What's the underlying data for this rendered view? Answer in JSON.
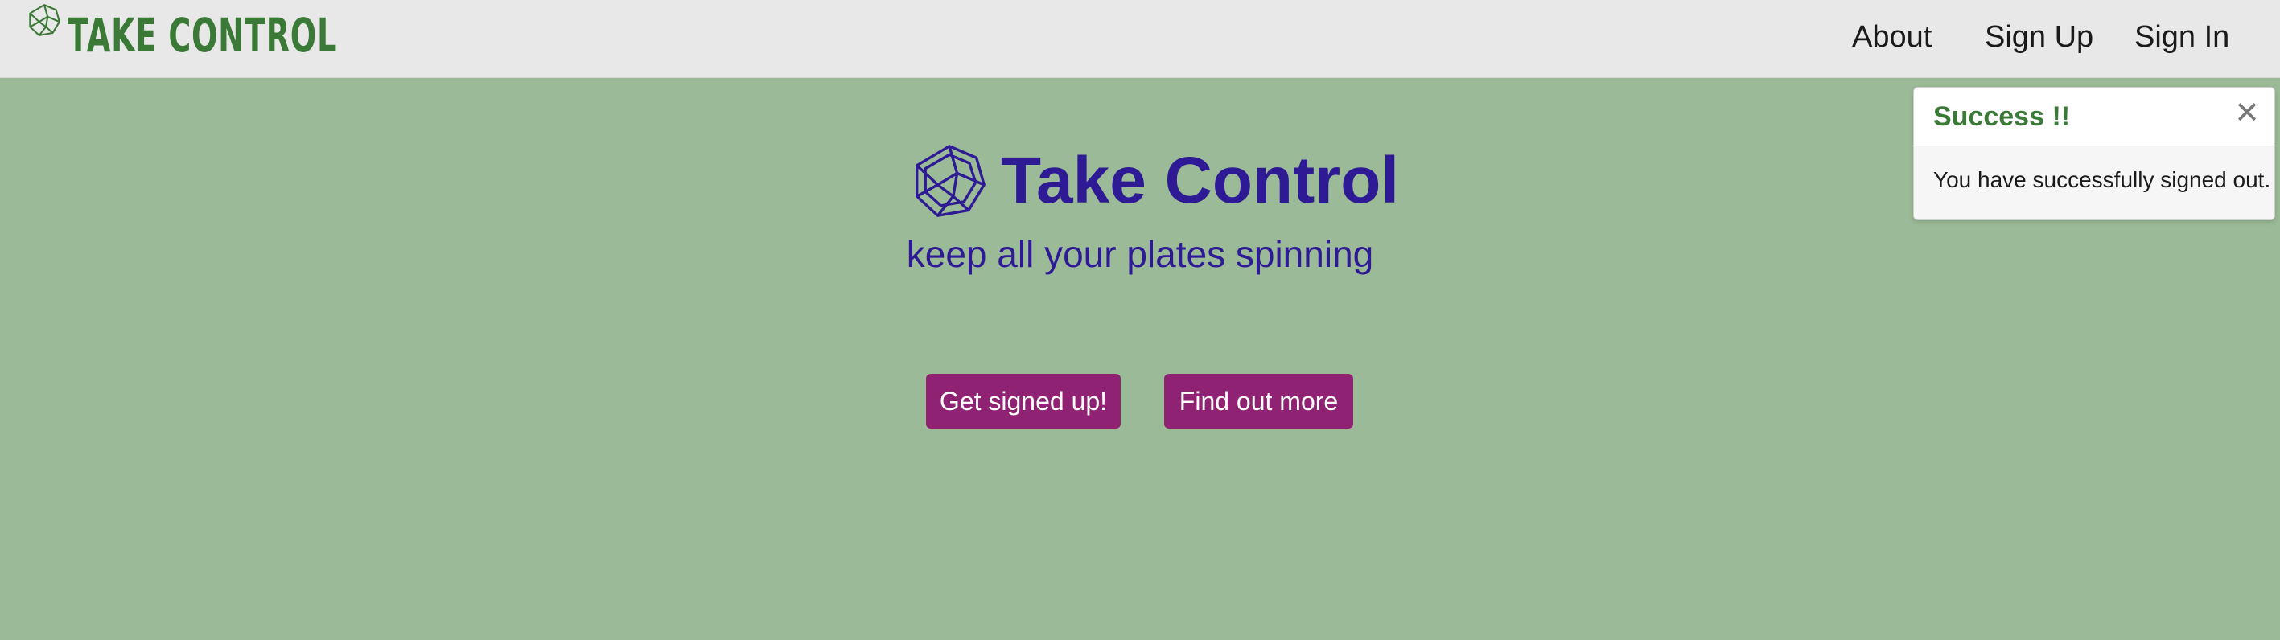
{
  "navbar": {
    "brand": {
      "text": "TAKE CONTROL",
      "icon": "spinning-plates-logo-icon"
    },
    "links": [
      {
        "label": "About"
      },
      {
        "label": "Sign Up"
      },
      {
        "label": "Sign In"
      }
    ]
  },
  "hero": {
    "icon": "spinning-plates-logo-icon",
    "title": "Take Control",
    "subtitle": "keep all your plates spinning",
    "buttons": {
      "signup_label": "Get signed up!",
      "more_label": "Find out more"
    }
  },
  "toast": {
    "title": "Success !!",
    "close_symbol": "✕",
    "close_icon": "close-icon",
    "message": "You have successfully signed out."
  },
  "colors": {
    "background": "#9bba97",
    "navbar": "#e9e8e9",
    "brand": "#3b7a36",
    "hero_text": "#2e1a94",
    "button": "#8f2272",
    "toast_title": "#3b7a36"
  }
}
